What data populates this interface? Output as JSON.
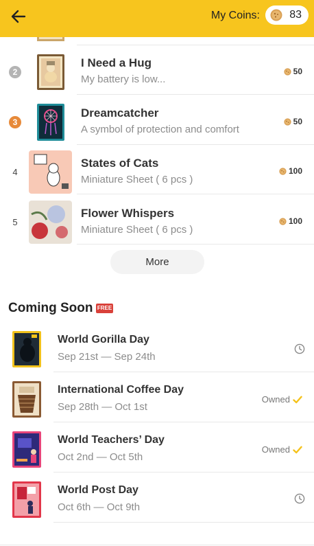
{
  "header": {
    "coins_label": "My Coins:",
    "coins_value": "83",
    "back_icon": "arrow-left-icon",
    "coin_icon": "coin-icon",
    "accent_color": "#f7c51e"
  },
  "ranking": {
    "items": [
      {
        "rank": "2",
        "title": "I Need a Hug",
        "subtitle": "My battery is low...",
        "price": "50"
      },
      {
        "rank": "3",
        "title": "Dreamcatcher",
        "subtitle": "A symbol of protection and comfort",
        "price": "50"
      },
      {
        "rank": "4",
        "title": "States of Cats",
        "subtitle": "Miniature Sheet ( 6 pcs )",
        "price": "100"
      },
      {
        "rank": "5",
        "title": "Flower Whispers",
        "subtitle": "Miniature Sheet ( 6 pcs )",
        "price": "100"
      }
    ],
    "more_label": "More"
  },
  "coming_soon": {
    "title": "Coming Soon",
    "badge": "FREE",
    "items": [
      {
        "title": "World Gorilla Day",
        "dates": "Sep 21st — Sep 24th",
        "status_icon": "clock-icon"
      },
      {
        "title": "International Coffee Day",
        "dates": "Sep 28th — Oct 1st",
        "status": "Owned",
        "status_icon": "checkmark-icon"
      },
      {
        "title": "World Teachers’ Day",
        "dates": "Oct 2nd — Oct 5th",
        "status": "Owned",
        "status_icon": "checkmark-icon"
      },
      {
        "title": "World Post Day",
        "dates": "Oct 6th — Oct 9th",
        "status_icon": "clock-icon"
      }
    ]
  }
}
